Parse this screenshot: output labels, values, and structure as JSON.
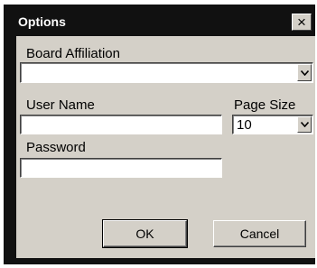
{
  "window": {
    "title": "Options",
    "close_glyph": "×"
  },
  "form": {
    "board_affiliation": {
      "label": "Board Affiliation",
      "value": ""
    },
    "user_name": {
      "label": "User Name",
      "value": ""
    },
    "page_size": {
      "label": "Page Size",
      "value": "10"
    },
    "password": {
      "label": "Password",
      "value": ""
    }
  },
  "buttons": {
    "ok_label": "OK",
    "cancel_label": "Cancel"
  },
  "icons": {
    "close": "close-icon",
    "dropdown": "chevron-down-icon"
  },
  "colors": {
    "frame": "#111111",
    "title_text": "#ffffff",
    "dialog_face": "#d4d0c8",
    "field_background": "#ffffff"
  }
}
